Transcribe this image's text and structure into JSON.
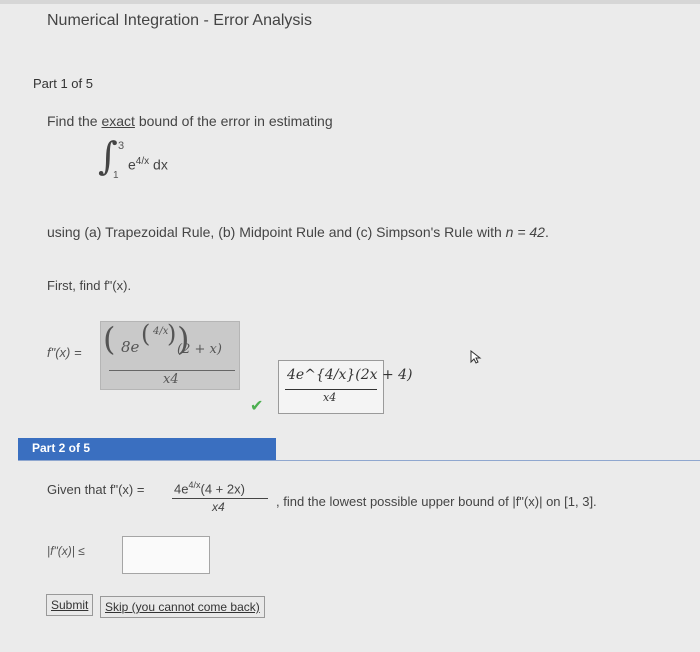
{
  "header": {
    "title": "Numerical Integration - Error Analysis"
  },
  "part1": {
    "label": "Part 1 of 5",
    "prompt_before": "Find the ",
    "prompt_emph": "exact",
    "prompt_after": " bound of the error in estimating",
    "integral": {
      "upper": "3",
      "lower": "1",
      "integrand": "e",
      "exponent": "4/x",
      "dx": " dx"
    },
    "using_text": "using (a) Trapezoidal Rule, (b) Midpoint Rule and (c) Simpson's Rule with",
    "n_text": "n = 42",
    "first_find": "First, find f\"(x).",
    "fpp_label": "f\"(x) =",
    "student_answer": {
      "num": "8e",
      "frac": "4/x",
      "tail": "(2 + x)",
      "den": "x4"
    },
    "correct_answer": {
      "num": "4e^{4/x}(2x + 4)",
      "den": "x4"
    },
    "colors": {
      "check": "#4caf50"
    }
  },
  "part2": {
    "label": "Part 2 of 5",
    "given_prefix": "Given that f\"(x) =",
    "given_num_base": "4e",
    "given_num_exp": "4/x",
    "given_num_tail": "(4 + 2x)",
    "given_den": "x4",
    "given_suffix": ", find the lowest possible upper bound of |f\"(x)| on [1, 3].",
    "bound_label": "|f\"(x)| ≤",
    "input_value": "",
    "submit_label": "Submit",
    "skip_label": "Skip (you cannot come back)",
    "bar_color": "#3a6fc0"
  }
}
